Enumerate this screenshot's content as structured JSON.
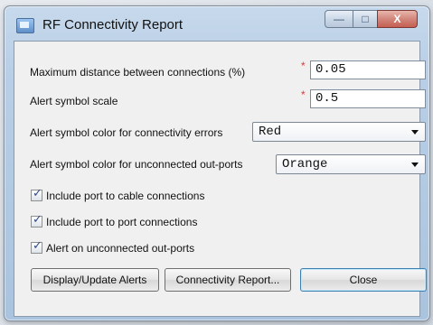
{
  "window": {
    "title": "RF Connectivity Report",
    "controls": {
      "minimize": "—",
      "maximize": "□",
      "close": "X"
    }
  },
  "fields": {
    "max_distance_label": "Maximum distance between connections (%)",
    "max_distance_value": "0.05",
    "symbol_scale_label": "Alert symbol scale",
    "symbol_scale_value": "0.5",
    "required_marker": "*"
  },
  "dropdowns": {
    "connectivity_errors_label": "Alert symbol color for connectivity errors",
    "connectivity_errors_value": "Red",
    "unconnected_outports_label": "Alert symbol color for unconnected out-ports",
    "unconnected_outports_value": "Orange"
  },
  "checkboxes": [
    {
      "label": "Include port to cable connections",
      "checked": true
    },
    {
      "label": "Include port to port connections",
      "checked": true
    },
    {
      "label": "Alert on unconnected out-ports",
      "checked": true
    }
  ],
  "buttons": {
    "display_update": "Display/Update Alerts",
    "connectivity_report": "Connectivity Report...",
    "close": "Close"
  },
  "icons": {
    "window": "rf-report-icon",
    "check": "check-mark-icon",
    "dropdown": "dropdown-arrow-icon"
  }
}
